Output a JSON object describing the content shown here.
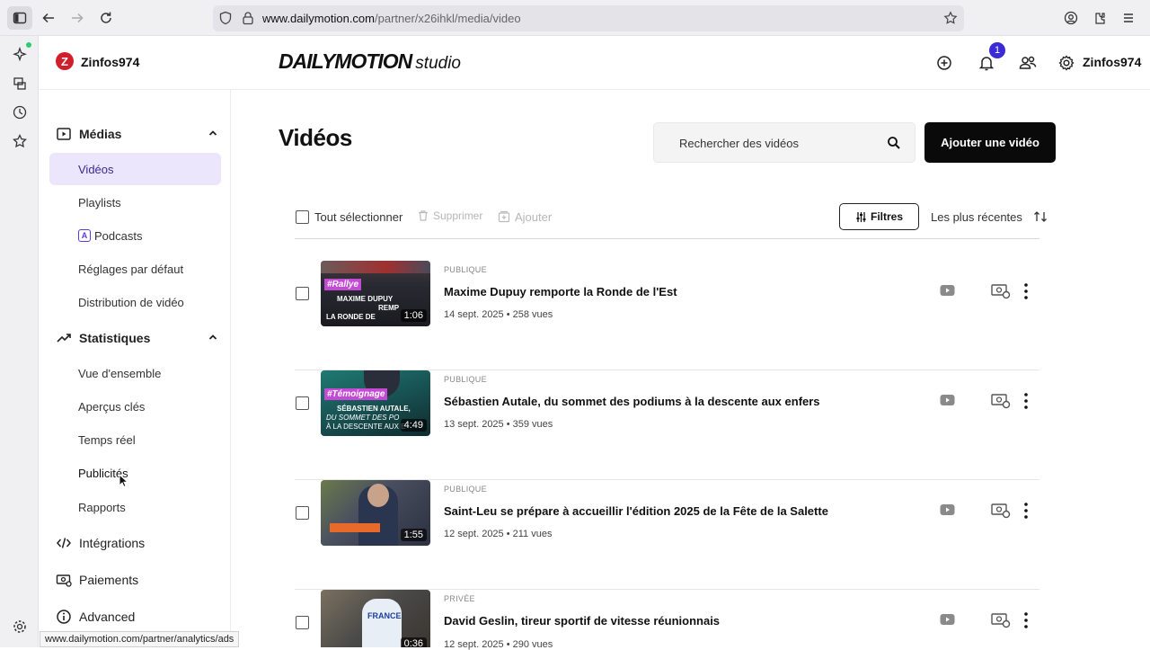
{
  "browser": {
    "url_host": "www.dailymotion.com",
    "url_path": "/partner/x26ihkl/media/video",
    "status_url": "www.dailymotion.com/partner/analytics/ads"
  },
  "header": {
    "channel_name": "Zinfos974",
    "channel_logo_letter": "Z",
    "brand": "DAILYMOTION",
    "brand_suffix": "studio",
    "notifications_count": "1",
    "user_name": "Zinfos974"
  },
  "nav": {
    "medias": "Médias",
    "videos": "Vidéos",
    "playlists": "Playlists",
    "podcasts": "Podcasts",
    "podcasts_badge": "A",
    "default_settings": "Réglages par défaut",
    "distribution": "Distribution de vidéo",
    "stats": "Statistiques",
    "overview": "Vue d'ensemble",
    "key_insights": "Aperçus clés",
    "realtime": "Temps réel",
    "ads": "Publicités",
    "reports": "Rapports",
    "integrations": "Intégrations",
    "payments": "Paiements",
    "advanced": "Advanced"
  },
  "main": {
    "title": "Vidéos",
    "search_placeholder": "Rechercher des vidéos",
    "add_button": "Ajouter une vidéo",
    "select_all": "Tout sélectionner",
    "delete": "Supprimer",
    "add": "Ajouter",
    "filters": "Filtres",
    "sort": "Les plus récentes"
  },
  "videos": [
    {
      "status": "PUBLIQUE",
      "title": "Maxime Dupuy remporte la Ronde de l'Est",
      "meta": "14 sept. 2025 • 258 vues",
      "duration": "1:06",
      "thumb_tag": "#Rallye",
      "thumb_l1": "MAXIME DUPUY",
      "thumb_l2": "REMP",
      "thumb_l3": "LA RONDE DE"
    },
    {
      "status": "PUBLIQUE",
      "title": "Sébastien Autale, du sommet des podiums à la descente aux enfers",
      "meta": "13 sept. 2025 • 359 vues",
      "duration": "4:49",
      "thumb_tag": "#Témoignage",
      "thumb_l1": "SÉBASTIEN AUTALE,",
      "thumb_l2": "DU SOMMET DES PO",
      "thumb_l3": "À LA DESCENTE AUX E"
    },
    {
      "status": "PUBLIQUE",
      "title": "Saint-Leu se prépare à accueillir l'édition 2025 de la Fête de la Salette",
      "meta": "12 sept. 2025 • 211 vues",
      "duration": "1:55",
      "thumb_tag": "",
      "thumb_l1": "",
      "thumb_l2": "",
      "thumb_l3": ""
    },
    {
      "status": "PRIVÉE",
      "title": "David Geslin, tireur sportif de vitesse réunionnais",
      "meta": "12 sept. 2025 • 290 vues",
      "duration": "0:36",
      "thumb_tag": "",
      "thumb_l1": "FRANCE",
      "thumb_l2": "",
      "thumb_l3": ""
    }
  ],
  "colors": {
    "accent": "#3b2bd6",
    "active_nav_bg": "#ece6fd",
    "primary_button": "#0a0a0a",
    "logo_red": "#d01f2a"
  }
}
